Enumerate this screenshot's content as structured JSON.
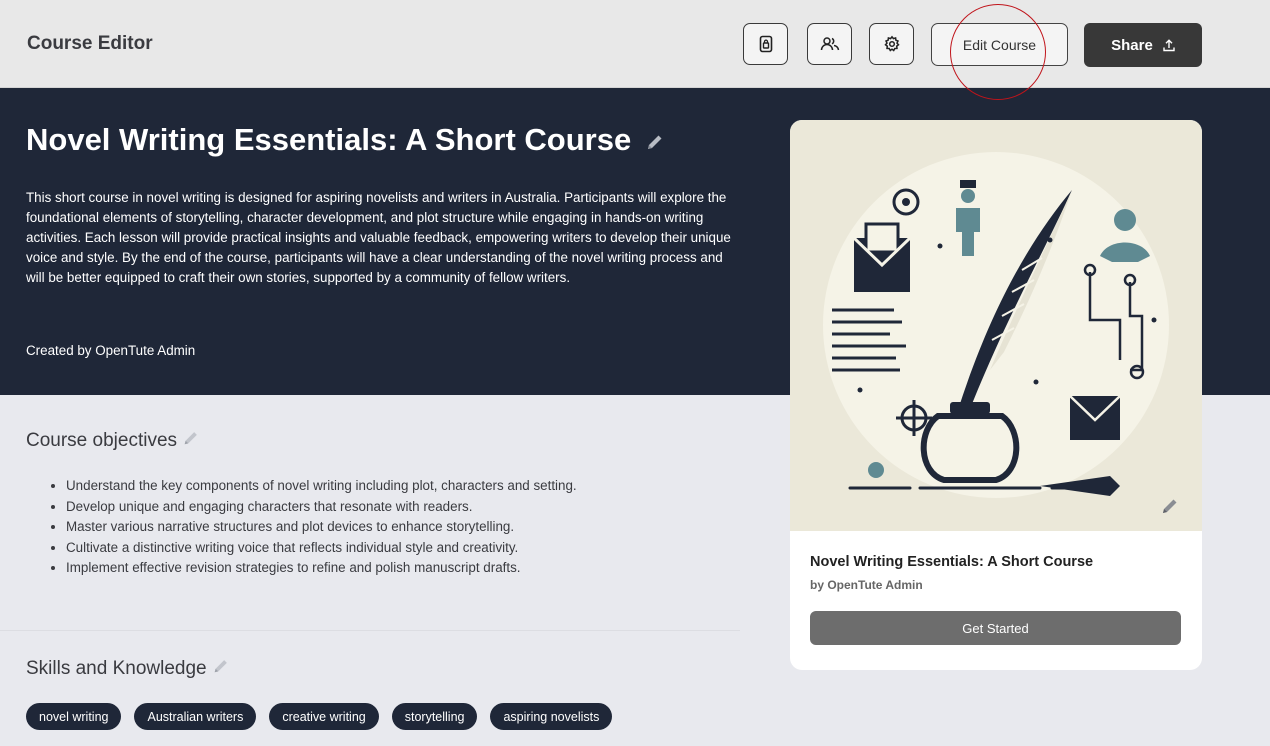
{
  "header": {
    "title": "Course Editor",
    "edit_label": "Edit Course",
    "share_label": "Share"
  },
  "hero": {
    "title": "Novel Writing Essentials: A Short Course",
    "description": "This short course in novel writing is designed for aspiring novelists and writers in Australia. Participants will explore the foundational elements of storytelling, character development, and plot structure while engaging in hands-on writing activities. Each lesson will provide practical insights and valuable feedback, empowering writers to develop their unique voice and style. By the end of the course, participants will have a clear understanding of the novel writing process and will be better equipped to craft their own stories, supported by a community of fellow writers.",
    "created_by": "Created by OpenTute Admin"
  },
  "objectives": {
    "heading": "Course objectives",
    "items": [
      "Understand the key components of novel writing including plot, characters and setting.",
      "Develop unique and engaging characters that resonate with readers.",
      "Master various narrative structures and plot devices to enhance storytelling.",
      "Cultivate a distinctive writing voice that reflects individual style and creativity.",
      "Implement effective revision strategies to refine and polish manuscript drafts."
    ]
  },
  "skills": {
    "heading": "Skills and Knowledge",
    "tags": [
      "novel writing",
      "Australian writers",
      "creative writing",
      "storytelling",
      "aspiring novelists"
    ]
  },
  "card": {
    "title": "Novel Writing Essentials: A Short Course",
    "author": "by OpenTute Admin",
    "cta": "Get Started"
  },
  "icons": {
    "toolbar": [
      "document-icon",
      "users-icon",
      "gear-icon"
    ],
    "share": "upload-icon",
    "edit": "pencil-icon"
  },
  "colors": {
    "hero_bg": "#1f2738",
    "page_bg": "#e8e9ee",
    "share_bg": "#383838",
    "annotation_circle": "#c0141b"
  }
}
